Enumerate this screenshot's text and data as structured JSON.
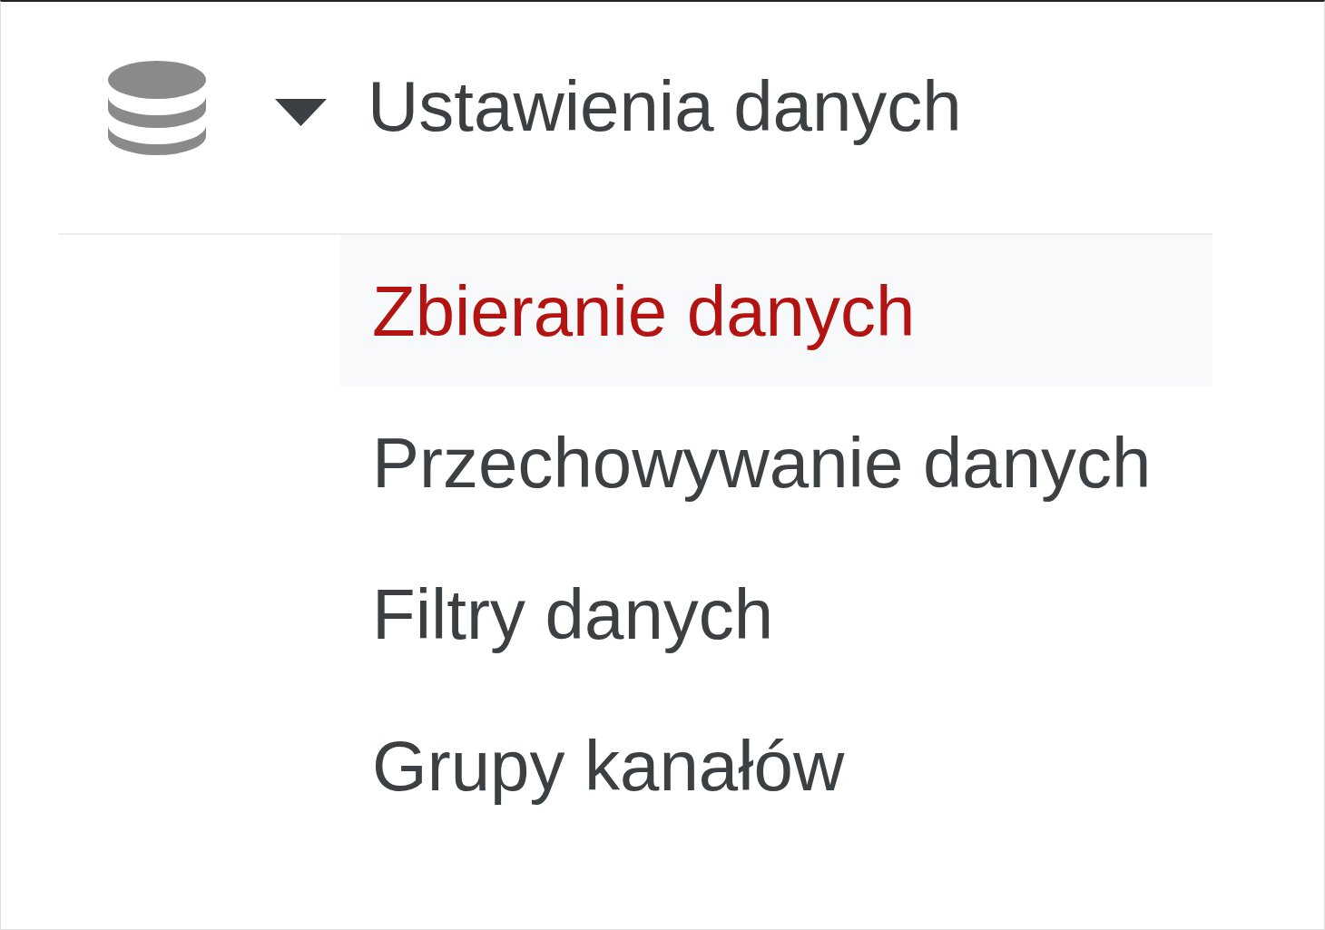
{
  "section": {
    "title": "Ustawienia danych",
    "expanded": true,
    "items": [
      {
        "label": "Zbieranie danych",
        "selected": true
      },
      {
        "label": "Przechowywanie danych",
        "selected": false
      },
      {
        "label": "Filtry danych",
        "selected": false
      },
      {
        "label": "Grupy kanałów",
        "selected": false
      }
    ]
  }
}
